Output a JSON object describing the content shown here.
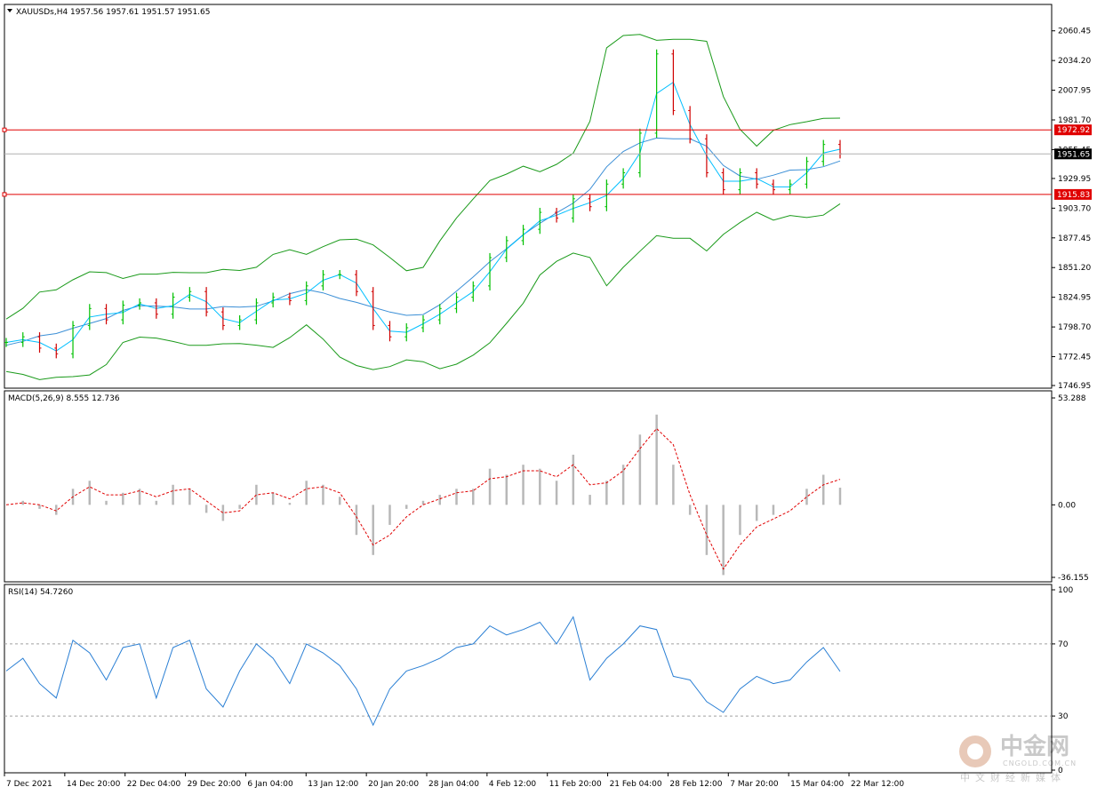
{
  "header": {
    "symbol_line": "XAUUSDs,H4  1957.56 1957.61 1951.57 1951.65"
  },
  "colors": {
    "up_bar": "#00c000",
    "down_bar": "#d00000",
    "bollinger": "#1a9a1a",
    "ma_fast": "#00bfff",
    "ma_slow": "#3b8fd6",
    "hline": "#e00000",
    "macd_hist": "#b8b8b8",
    "macd_signal": "#e00000",
    "rsi": "#2a7fd4"
  },
  "chart_data": [
    {
      "type": "line",
      "name": "price",
      "header": "XAUUSDs,H4  1957.56 1957.61 1951.57 1951.65",
      "ylim": [
        1746.95,
        2072
      ],
      "y_ticks": [
        "2060.45",
        "2034.20",
        "2007.95",
        "1981.70",
        "1955.45",
        "1929.95",
        "1903.70",
        "1877.45",
        "1851.20",
        "1824.95",
        "1798.70",
        "1772.45",
        "1746.95"
      ],
      "x": [
        0,
        5,
        10,
        15,
        20,
        25,
        30,
        35,
        40,
        45,
        50,
        55,
        60,
        65,
        70,
        75,
        80,
        85,
        90,
        95,
        100,
        105,
        110,
        115,
        120,
        125,
        130,
        135,
        140,
        145,
        150,
        155,
        160,
        165,
        170,
        175,
        180,
        185,
        190,
        195,
        200,
        205,
        210,
        215,
        220,
        225,
        230,
        235,
        240,
        245,
        250
      ],
      "values": [
        1785,
        1790,
        1780,
        1775,
        1800,
        1815,
        1805,
        1818,
        1820,
        1810,
        1825,
        1830,
        1812,
        1800,
        1805,
        1820,
        1825,
        1822,
        1835,
        1845,
        1845,
        1830,
        1800,
        1790,
        1798,
        1805,
        1815,
        1825,
        1835,
        1860,
        1875,
        1885,
        1900,
        1895,
        1912,
        1905,
        1925,
        1935,
        1970,
        2040,
        1990,
        1965,
        1935,
        1920,
        1935,
        1925,
        1920,
        1925,
        1945,
        1960,
        1951.65
      ],
      "h_lines": [
        {
          "label": "1972.92",
          "value": 1972.92
        },
        {
          "label": "1915.83",
          "value": 1915.83
        }
      ],
      "current_price": {
        "label": "1951.65",
        "value": 1951.65
      }
    },
    {
      "type": "bar",
      "name": "macd",
      "header": "MACD(5,26,9) 8.555 12.736",
      "ylim": [
        -36.155,
        53.288
      ],
      "y_ticks": [
        "53.288",
        "0.00",
        "-36.155"
      ],
      "x": [
        0,
        5,
        10,
        15,
        20,
        25,
        30,
        35,
        40,
        45,
        50,
        55,
        60,
        65,
        70,
        75,
        80,
        85,
        90,
        95,
        100,
        105,
        110,
        115,
        120,
        125,
        130,
        135,
        140,
        145,
        150,
        155,
        160,
        165,
        170,
        175,
        180,
        185,
        190,
        195,
        200,
        205,
        210,
        215,
        220,
        225,
        230,
        235,
        240,
        245,
        250
      ],
      "values": [
        0,
        2,
        -2,
        -5,
        8,
        12,
        2,
        6,
        8,
        2,
        10,
        8,
        -4,
        -8,
        -2,
        10,
        6,
        1,
        12,
        10,
        4,
        -15,
        -25,
        -10,
        -2,
        2,
        5,
        8,
        8,
        18,
        15,
        20,
        18,
        12,
        25,
        5,
        12,
        20,
        35,
        45,
        20,
        -5,
        -25,
        -35,
        -15,
        -8,
        -5,
        0,
        8,
        15,
        8.555
      ],
      "signal": [
        0,
        1,
        0,
        -3,
        4,
        9,
        5,
        5,
        7,
        4,
        7,
        8,
        2,
        -4,
        -3,
        5,
        6,
        3,
        8,
        9,
        6,
        -6,
        -20,
        -15,
        -6,
        0,
        3,
        6,
        7,
        13,
        14,
        17,
        17,
        14,
        20,
        10,
        11,
        17,
        28,
        38,
        30,
        5,
        -15,
        -32,
        -20,
        -11,
        -7,
        -3,
        4,
        10,
        12.736
      ]
    },
    {
      "type": "line",
      "name": "rsi",
      "header": "RSI(14) 54.7260",
      "ylim": [
        0,
        100
      ],
      "y_ticks": [
        "100",
        "70",
        "30",
        "0"
      ],
      "levels": [
        70,
        30
      ],
      "x": [
        0,
        5,
        10,
        15,
        20,
        25,
        30,
        35,
        40,
        45,
        50,
        55,
        60,
        65,
        70,
        75,
        80,
        85,
        90,
        95,
        100,
        105,
        110,
        115,
        120,
        125,
        130,
        135,
        140,
        145,
        150,
        155,
        160,
        165,
        170,
        175,
        180,
        185,
        190,
        195,
        200,
        205,
        210,
        215,
        220,
        225,
        230,
        235,
        240,
        245,
        250
      ],
      "values": [
        55,
        62,
        48,
        40,
        72,
        65,
        50,
        68,
        70,
        40,
        68,
        72,
        45,
        35,
        55,
        70,
        62,
        48,
        70,
        65,
        58,
        45,
        25,
        45,
        55,
        58,
        62,
        68,
        70,
        80,
        75,
        78,
        82,
        70,
        85,
        50,
        62,
        70,
        80,
        78,
        52,
        50,
        38,
        32,
        45,
        52,
        48,
        50,
        60,
        68,
        54.726
      ]
    }
  ],
  "x_axis": {
    "labels": [
      "7 Dec 2021",
      "14 Dec 20:00",
      "22 Dec 04:00",
      "29 Dec 20:00",
      "6 Jan 04:00",
      "13 Jan 12:00",
      "20 Jan 20:00",
      "28 Jan 04:00",
      "4 Feb 12:00",
      "11 Feb 20:00",
      "21 Feb 04:00",
      "28 Feb 12:00",
      "7 Mar 20:00",
      "15 Mar 04:00",
      "22 Mar 12:00"
    ]
  },
  "watermark": {
    "brand_cn": "中金网",
    "brand_en": "CNGOLD.COM.CN",
    "slogan": "中文财经新媒体"
  }
}
